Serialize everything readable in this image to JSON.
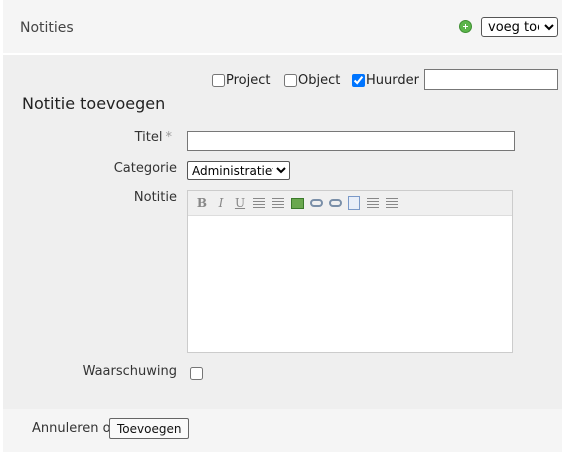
{
  "header": {
    "title": "Notities",
    "action_select_value": "voeg toe",
    "add_icon": "plus-circle-icon"
  },
  "filters": {
    "project": {
      "label": "Project",
      "checked": false
    },
    "object": {
      "label": "Object",
      "checked": false
    },
    "huurder": {
      "label": "Huurder",
      "checked": true
    },
    "search_value": ""
  },
  "form": {
    "title": "Notitie toevoegen",
    "titel_label": "Titel",
    "required_marker": "*",
    "titel_value": "",
    "categorie_label": "Categorie",
    "categorie_value": "Administratief",
    "notitie_label": "Notitie",
    "toolbar_icons": [
      "bold-icon",
      "italic-icon",
      "underline-icon",
      "ordered-list-icon",
      "unordered-list-icon",
      "image-icon",
      "link-icon",
      "unlink-icon",
      "html-source-icon",
      "indent-icon",
      "outdent-icon"
    ],
    "bold_glyph": "B",
    "italic_glyph": "I",
    "underline_glyph": "U",
    "waarschuwing_label": "Waarschuwing",
    "waarschuwing_checked": false
  },
  "footer": {
    "cancel_label": "Annuleren of",
    "submit_label": "Toevoegen"
  },
  "colors": {
    "panel_bg": "#efefef",
    "header_bg": "#f5f5f5",
    "add_icon": "#5bb54a"
  }
}
